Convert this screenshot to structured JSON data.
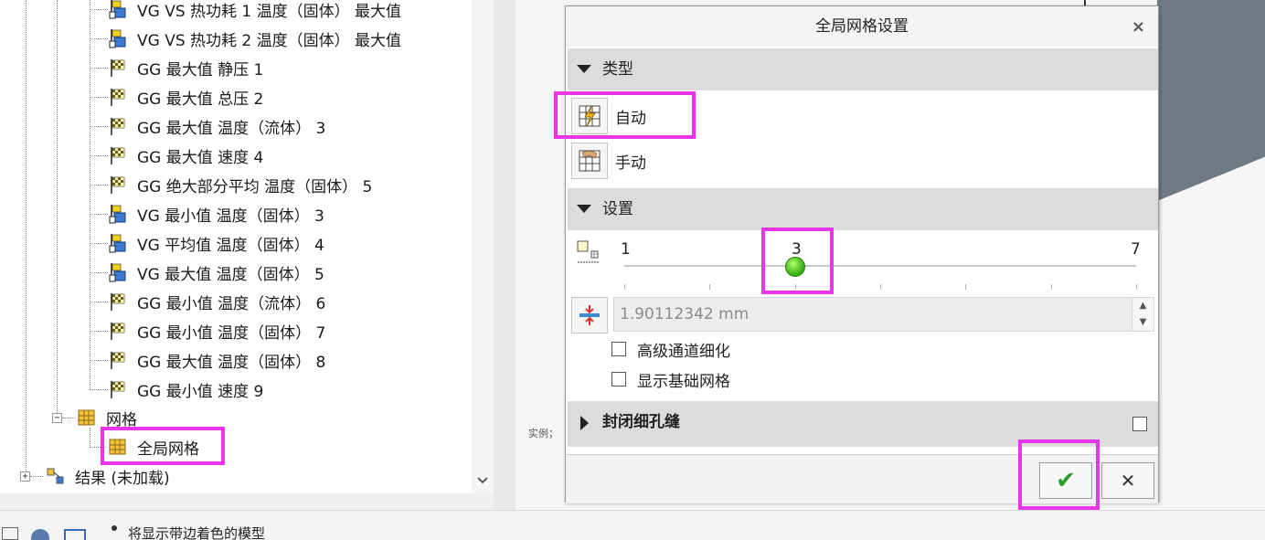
{
  "tree": {
    "items": [
      {
        "label": "VG VS 热功耗 1 温度（固体） 最大值",
        "icon": "vg-result-icon"
      },
      {
        "label": "VG VS 热功耗 2 温度（固体） 最大值",
        "icon": "vg-result-icon"
      },
      {
        "label": "GG 最大值 静压 1",
        "icon": "checkered-flag-icon"
      },
      {
        "label": "GG 最大值 总压 2",
        "icon": "checkered-flag-icon"
      },
      {
        "label": "GG 最大值 温度（流体） 3",
        "icon": "checkered-flag-icon"
      },
      {
        "label": "GG 最大值 速度 4",
        "icon": "checkered-flag-icon"
      },
      {
        "label": "GG 绝大部分平均 温度（固体） 5",
        "icon": "checkered-flag-icon"
      },
      {
        "label": "VG 最小值 温度（固体） 3",
        "icon": "vg-result-icon"
      },
      {
        "label": "VG 平均值 温度（固体） 4",
        "icon": "vg-result-icon"
      },
      {
        "label": "VG 最大值 温度（固体） 5",
        "icon": "vg-result-icon"
      },
      {
        "label": "GG 最小值 温度（流体） 6",
        "icon": "checkered-flag-icon"
      },
      {
        "label": "GG 最小值 温度（固体） 7",
        "icon": "checkered-flag-icon"
      },
      {
        "label": "GG 最大值 温度（固体） 8",
        "icon": "checkered-flag-icon"
      },
      {
        "label": "GG 最小值 速度 9",
        "icon": "checkered-flag-icon"
      }
    ],
    "mesh_label": "网格",
    "global_mesh_label": "全局网格",
    "results_label": "结果 (未加载)",
    "mesh_expander": "−",
    "results_expander": "+"
  },
  "viewport": {
    "legend_snippet": "实例；"
  },
  "status": {
    "text": "将显示带边着色的模型"
  },
  "dialog": {
    "title": "全局网格设置",
    "close": "×",
    "type_section": "类型",
    "type_options": [
      {
        "label": "自动",
        "selected": true
      },
      {
        "label": "手动",
        "selected": false
      }
    ],
    "settings_section": "设置",
    "slider": {
      "min": "1",
      "value": "3",
      "max": "7",
      "current_level": 3,
      "range": [
        1,
        7
      ]
    },
    "min_size": {
      "value": "1.90112342 mm",
      "up": "▲",
      "down": "▼"
    },
    "checkboxes": [
      {
        "label": "高级通道细化",
        "checked": false
      },
      {
        "label": "显示基础网格",
        "checked": false
      }
    ],
    "close_gaps_section": "封闭细孔缝",
    "close_gaps_checked": false,
    "ok_label": "✔",
    "cancel_label": "✕"
  },
  "colors": {
    "highlight": "#e935e9",
    "ok_green": "#2e9a2e",
    "slider_knob": "#3fb51c"
  }
}
